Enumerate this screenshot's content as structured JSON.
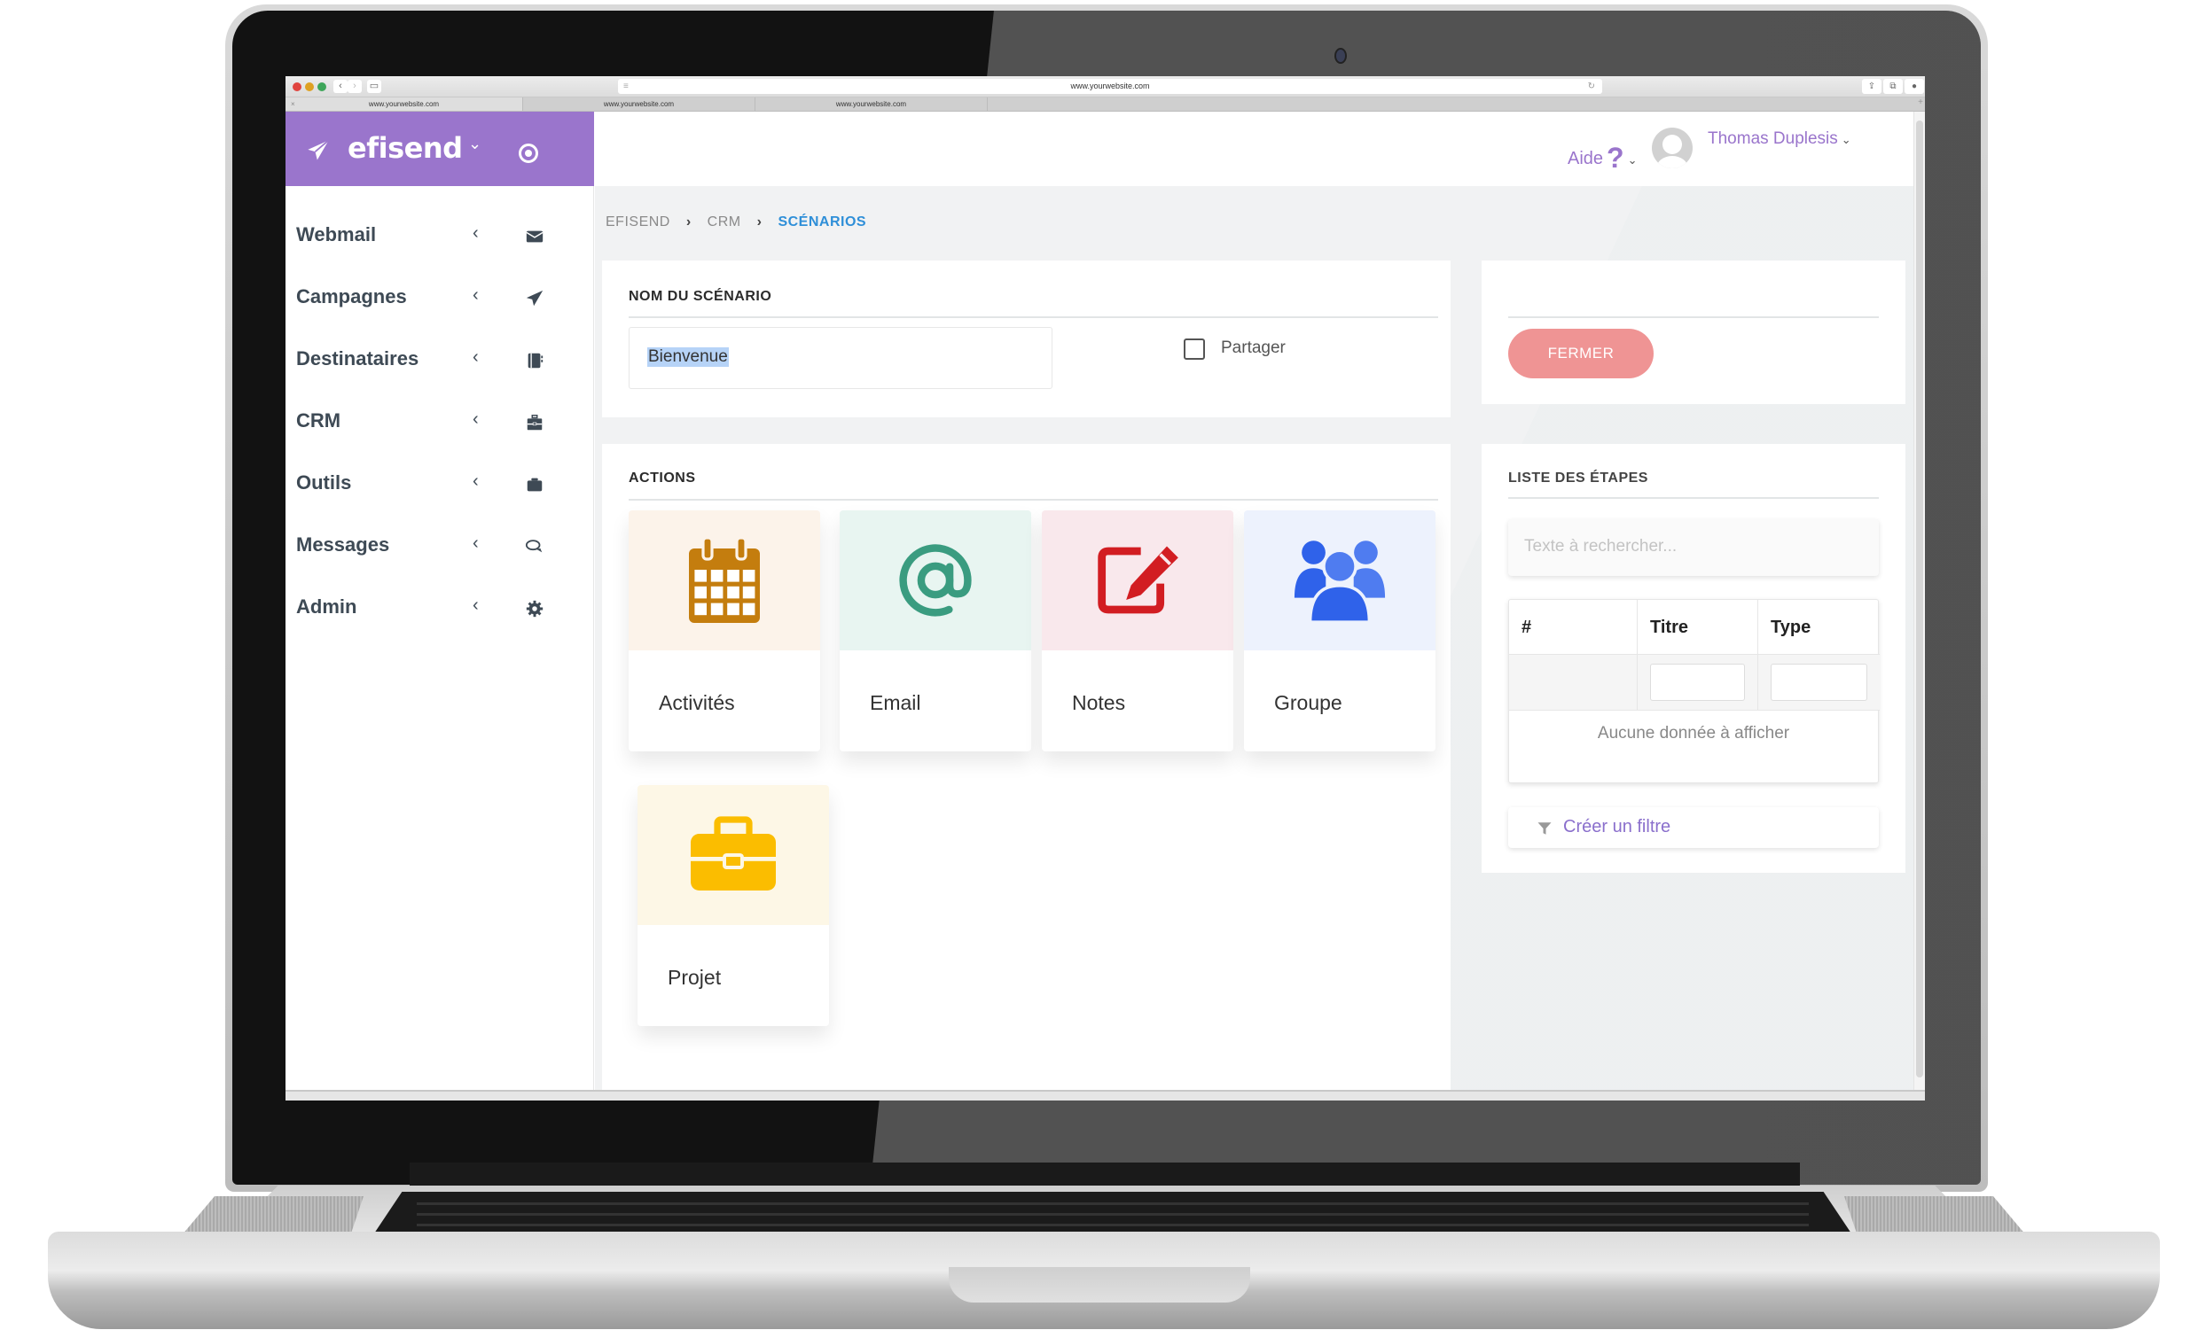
{
  "browser": {
    "address": "www.yourwebsite.com",
    "tabs": [
      {
        "label": "www.yourwebsite.com",
        "active": true
      },
      {
        "label": "www.yourwebsite.com",
        "active": false
      },
      {
        "label": "www.yourwebsite.com",
        "active": false
      }
    ],
    "close_tab_glyph": "×",
    "new_tab_glyph": "+",
    "back_glyph": "‹",
    "forward_glyph": "›",
    "reload_glyph": "↻",
    "toolbar_icons": [
      "share-icon",
      "tabs-icon",
      "extension-icon"
    ]
  },
  "app": {
    "brand_name": "efisend",
    "brand_caret": "⌄",
    "colors": {
      "brand": "#9a75cc",
      "breadcrumb_active": "#2f8fd8",
      "close_button": "#ef9494",
      "link": "#8a6fcc"
    }
  },
  "sidebar": {
    "items": [
      {
        "label": "Webmail",
        "icon": "envelope-icon"
      },
      {
        "label": "Campagnes",
        "icon": "paper-plane-icon"
      },
      {
        "label": "Destinataires",
        "icon": "address-book-icon"
      },
      {
        "label": "CRM",
        "icon": "toolbox-icon"
      },
      {
        "label": "Outils",
        "icon": "briefcase-icon"
      },
      {
        "label": "Messages",
        "icon": "chat-bubbles-icon"
      },
      {
        "label": "Admin",
        "icon": "gear-icon"
      }
    ],
    "chevron": "‹"
  },
  "header": {
    "help_label": "Aide",
    "help_glyph": "?",
    "caret": "⌄",
    "user_name": "Thomas Duplesis"
  },
  "breadcrumb": {
    "items": [
      "EFISEND",
      "CRM"
    ],
    "current": "SCÉNARIOS",
    "separator": "›"
  },
  "scenario": {
    "title": "NOM DU SCÉNARIO",
    "name_value": "Bienvenue",
    "share_label": "Partager",
    "share_checked": false
  },
  "side_actions": {
    "close_label": "FERMER"
  },
  "actions": {
    "title": "ACTIONS",
    "items": [
      {
        "label": "Activités",
        "icon": "calendar-icon",
        "bg": "#fcf3ea",
        "color": "#c47d0e"
      },
      {
        "label": "Email",
        "icon": "at-sign-icon",
        "bg": "#e8f5f1",
        "color": "#3a9c80"
      },
      {
        "label": "Notes",
        "icon": "edit-note-icon",
        "bg": "#f9e8ec",
        "color": "#d21d22"
      },
      {
        "label": "Groupe",
        "icon": "users-group-icon",
        "bg": "#edf2fd",
        "color": "#2f62ea"
      },
      {
        "label": "Projet",
        "icon": "briefcase-icon",
        "bg": "#fdf7e6",
        "color": "#fbbd00"
      }
    ]
  },
  "steps": {
    "title": "LISTE DES ÉTAPES",
    "search_placeholder": "Texte à rechercher...",
    "columns": [
      "#",
      "Titre",
      "Type"
    ],
    "rows": [],
    "empty_message": "Aucune donnée à afficher",
    "create_filter_label": "Créer un filtre"
  }
}
